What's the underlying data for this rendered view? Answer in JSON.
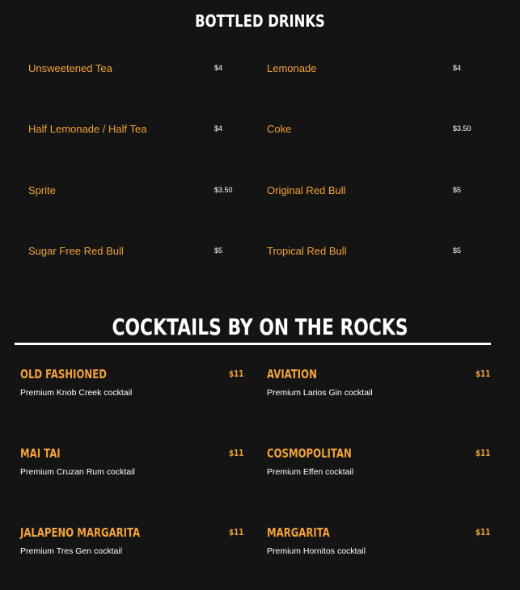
{
  "bottled": {
    "title": "BOTTLED DRINKS",
    "items": [
      {
        "name": "Unsweetened Tea",
        "price": "$4"
      },
      {
        "name": "Lemonade",
        "price": "$4"
      },
      {
        "name": "Half Lemonade / Half Tea",
        "price": "$4"
      },
      {
        "name": "Coke",
        "price": "$3.50"
      },
      {
        "name": "Sprite",
        "price": "$3.50"
      },
      {
        "name": "Original Red Bull",
        "price": "$5"
      },
      {
        "name": "Sugar Free Red Bull",
        "price": "$5"
      },
      {
        "name": "Tropical Red Bull",
        "price": "$5"
      }
    ]
  },
  "cocktails": {
    "title": "COCKTAILS BY ON THE ROCKS",
    "items": [
      {
        "name": "OLD FASHIONED",
        "price": "$11",
        "desc": "Premium Knob Creek cocktail"
      },
      {
        "name": "AVIATION",
        "price": "$11",
        "desc": "Premium Larios Gin cocktail"
      },
      {
        "name": "MAI TAI",
        "price": "$11",
        "desc": "Premium Cruzan Rum cocktail"
      },
      {
        "name": "COSMOPOLITAN",
        "price": "$11",
        "desc": "Premium Effen cocktail"
      },
      {
        "name": "JALAPENO MARGARITA",
        "price": "$11",
        "desc": "Premium Tres Gen cocktail"
      },
      {
        "name": "MARGARITA",
        "price": "$11",
        "desc": "Premium Hornitos cocktail"
      }
    ]
  }
}
